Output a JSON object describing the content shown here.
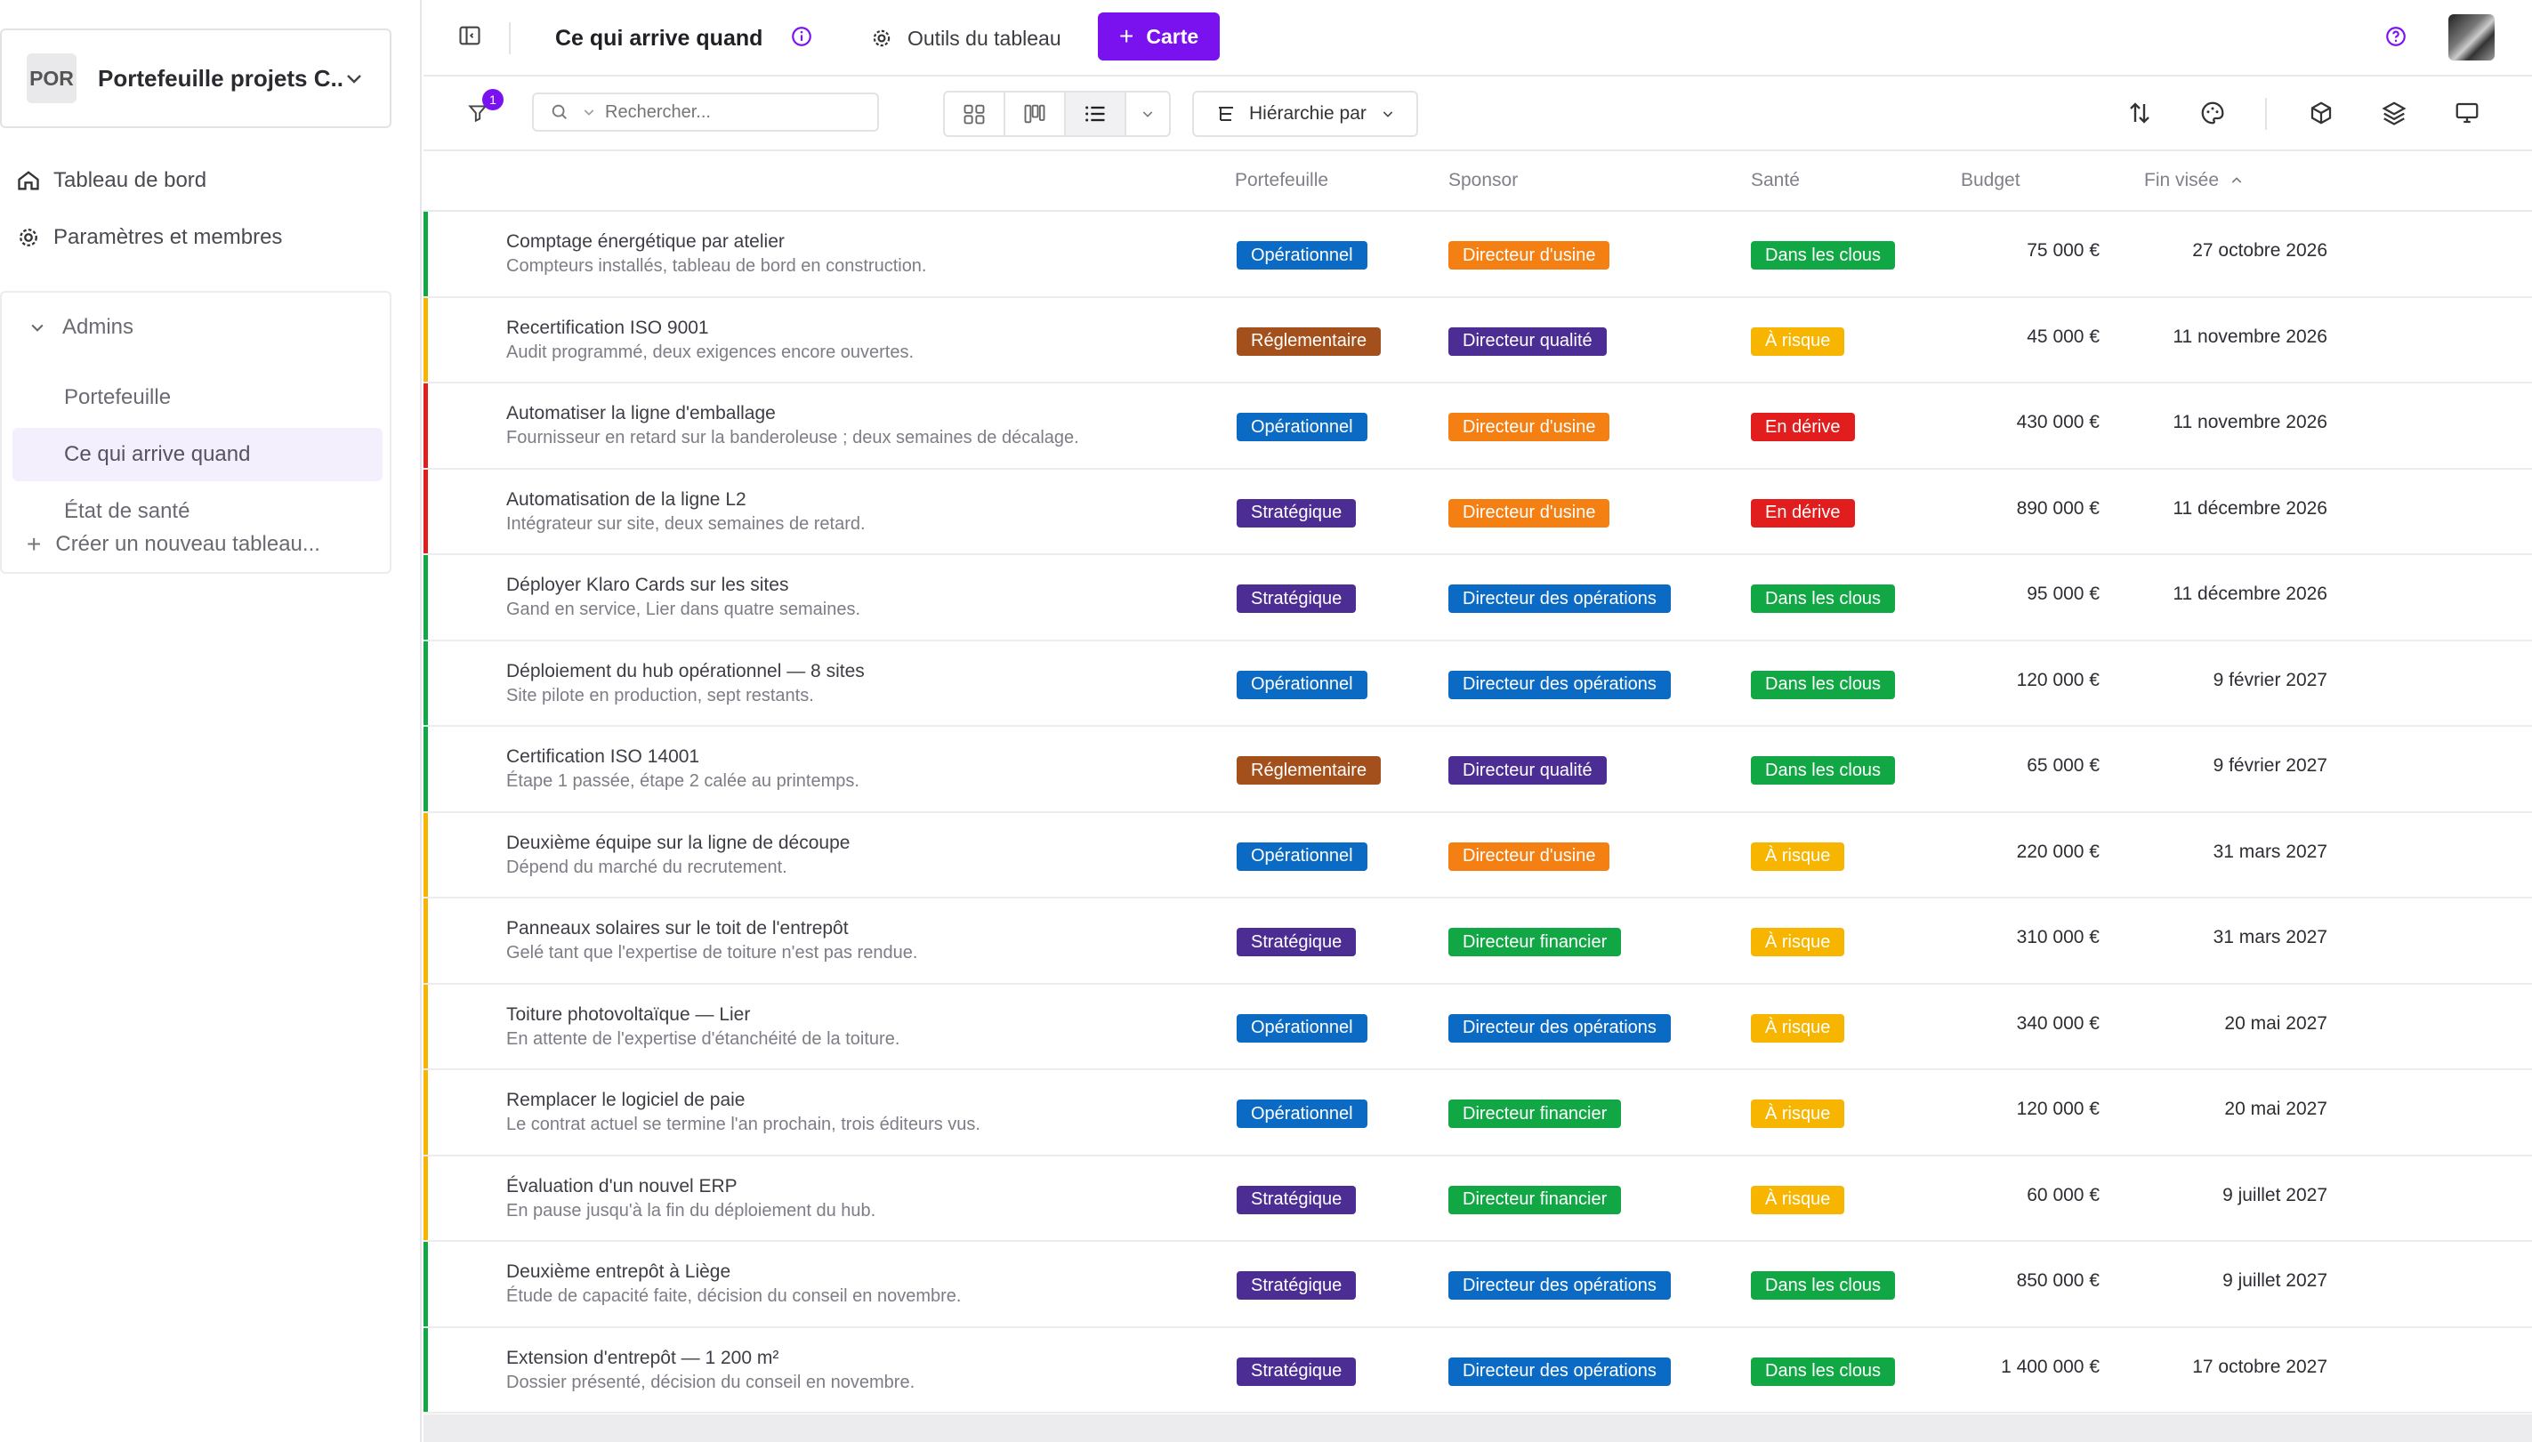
{
  "workspace": {
    "badge": "POR",
    "name": "Portefeuille projets C..."
  },
  "sidebar": {
    "dashboard": "Tableau de bord",
    "settings": "Paramètres et membres",
    "group": "Admins",
    "items": [
      {
        "label": "Portefeuille"
      },
      {
        "label": "Ce qui arrive quand"
      },
      {
        "label": "État de santé"
      }
    ],
    "create": "Créer un nouveau tableau..."
  },
  "topbar": {
    "title": "Ce qui arrive quand",
    "tools": "Outils du tableau",
    "add_card": "Carte"
  },
  "toolbar": {
    "filter_count": "1",
    "search_placeholder": "Rechercher...",
    "hierarchy": "Hiérarchie par"
  },
  "columns": {
    "portfolio": "Portefeuille",
    "sponsor": "Sponsor",
    "health": "Santé",
    "budget": "Budget",
    "due": "Fin visée"
  },
  "colors": {
    "accent": "#7a12f0",
    "Opérationnel": "#0b6bc4",
    "Réglementaire": "#a4501c",
    "Stratégique": "#4c2d93",
    "Directeur d'usine": "#f47f12",
    "Directeur qualité": "#4c2d93",
    "Directeur des opérations": "#0b6bc4",
    "Directeur financier": "#12a745",
    "Dans les clous": "#12a745",
    "À risque": "#f7b500",
    "En dérive": "#e11d1d"
  },
  "rows": [
    {
      "title": "Comptage énergétique par atelier",
      "sub": "Compteurs installés, tableau de bord en construction.",
      "portfolio": "Opérationnel",
      "sponsor": "Directeur d'usine",
      "health": "Dans les clous",
      "budget": "75 000 €",
      "due": "27 octobre 2026"
    },
    {
      "title": "Recertification ISO 9001",
      "sub": "Audit programmé, deux exigences encore ouvertes.",
      "portfolio": "Réglementaire",
      "sponsor": "Directeur qualité",
      "health": "À risque",
      "budget": "45 000 €",
      "due": "11 novembre 2026"
    },
    {
      "title": "Automatiser la ligne d'emballage",
      "sub": "Fournisseur en retard sur la banderoleuse ; deux semaines de décalage.",
      "portfolio": "Opérationnel",
      "sponsor": "Directeur d'usine",
      "health": "En dérive",
      "budget": "430 000 €",
      "due": "11 novembre 2026"
    },
    {
      "title": "Automatisation de la ligne L2",
      "sub": "Intégrateur sur site, deux semaines de retard.",
      "portfolio": "Stratégique",
      "sponsor": "Directeur d'usine",
      "health": "En dérive",
      "budget": "890 000 €",
      "due": "11 décembre 2026"
    },
    {
      "title": "Déployer Klaro Cards sur les sites",
      "sub": "Gand en service, Lier dans quatre semaines.",
      "portfolio": "Stratégique",
      "sponsor": "Directeur des opérations",
      "health": "Dans les clous",
      "budget": "95 000 €",
      "due": "11 décembre 2026"
    },
    {
      "title": "Déploiement du hub opérationnel — 8 sites",
      "sub": "Site pilote en production, sept restants.",
      "portfolio": "Opérationnel",
      "sponsor": "Directeur des opérations",
      "health": "Dans les clous",
      "budget": "120 000 €",
      "due": "9 février 2027"
    },
    {
      "title": "Certification ISO 14001",
      "sub": "Étape 1 passée, étape 2 calée au printemps.",
      "portfolio": "Réglementaire",
      "sponsor": "Directeur qualité",
      "health": "Dans les clous",
      "budget": "65 000 €",
      "due": "9 février 2027"
    },
    {
      "title": "Deuxième équipe sur la ligne de découpe",
      "sub": "Dépend du marché du recrutement.",
      "portfolio": "Opérationnel",
      "sponsor": "Directeur d'usine",
      "health": "À risque",
      "budget": "220 000 €",
      "due": "31 mars 2027"
    },
    {
      "title": "Panneaux solaires sur le toit de l'entrepôt",
      "sub": "Gelé tant que l'expertise de toiture n'est pas rendue.",
      "portfolio": "Stratégique",
      "sponsor": "Directeur financier",
      "health": "À risque",
      "budget": "310 000 €",
      "due": "31 mars 2027"
    },
    {
      "title": "Toiture photovoltaïque — Lier",
      "sub": "En attente de l'expertise d'étanchéité de la toiture.",
      "portfolio": "Opérationnel",
      "sponsor": "Directeur des opérations",
      "health": "À risque",
      "budget": "340 000 €",
      "due": "20 mai 2027"
    },
    {
      "title": "Remplacer le logiciel de paie",
      "sub": "Le contrat actuel se termine l'an prochain, trois éditeurs vus.",
      "portfolio": "Opérationnel",
      "sponsor": "Directeur financier",
      "health": "À risque",
      "budget": "120 000 €",
      "due": "20 mai 2027"
    },
    {
      "title": "Évaluation d'un nouvel ERP",
      "sub": "En pause jusqu'à la fin du déploiement du hub.",
      "portfolio": "Stratégique",
      "sponsor": "Directeur financier",
      "health": "À risque",
      "budget": "60 000 €",
      "due": "9 juillet 2027"
    },
    {
      "title": "Deuxième entrepôt à Liège",
      "sub": "Étude de capacité faite, décision du conseil en novembre.",
      "portfolio": "Stratégique",
      "sponsor": "Directeur des opérations",
      "health": "Dans les clous",
      "budget": "850 000 €",
      "due": "9 juillet 2027"
    },
    {
      "title": "Extension d'entrepôt — 1 200 m²",
      "sub": "Dossier présenté, décision du conseil en novembre.",
      "portfolio": "Stratégique",
      "sponsor": "Directeur des opérations",
      "health": "Dans les clous",
      "budget": "1 400 000 €",
      "due": "17 octobre 2027"
    }
  ]
}
